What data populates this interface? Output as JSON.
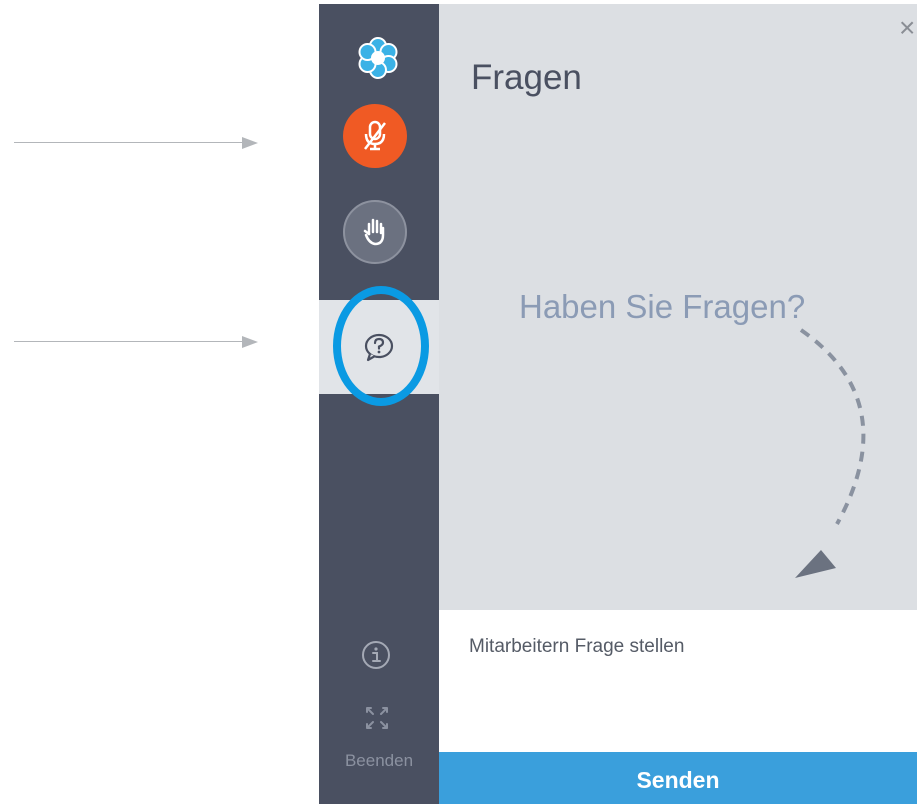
{
  "sidebar": {
    "logo_icon": "flower-logo-icon",
    "mute_icon": "microphone-muted-icon",
    "raise_hand_icon": "raise-hand-icon",
    "questions_icon": "question-bubble-icon",
    "info_icon": "info-icon",
    "fullscreen_icon": "fullscreen-icon",
    "end_label": "Beenden"
  },
  "panel": {
    "title": "Fragen",
    "close_label": "×",
    "empty_message": "Haben Sie Fragen?",
    "input_placeholder": "Mitarbeitern Frage stellen",
    "send_label": "Senden"
  },
  "colors": {
    "sidebar_bg": "#4a5061",
    "mute_button": "#f05a24",
    "highlight_ring": "#0a9ae3",
    "send_button": "#3a9fdc"
  }
}
